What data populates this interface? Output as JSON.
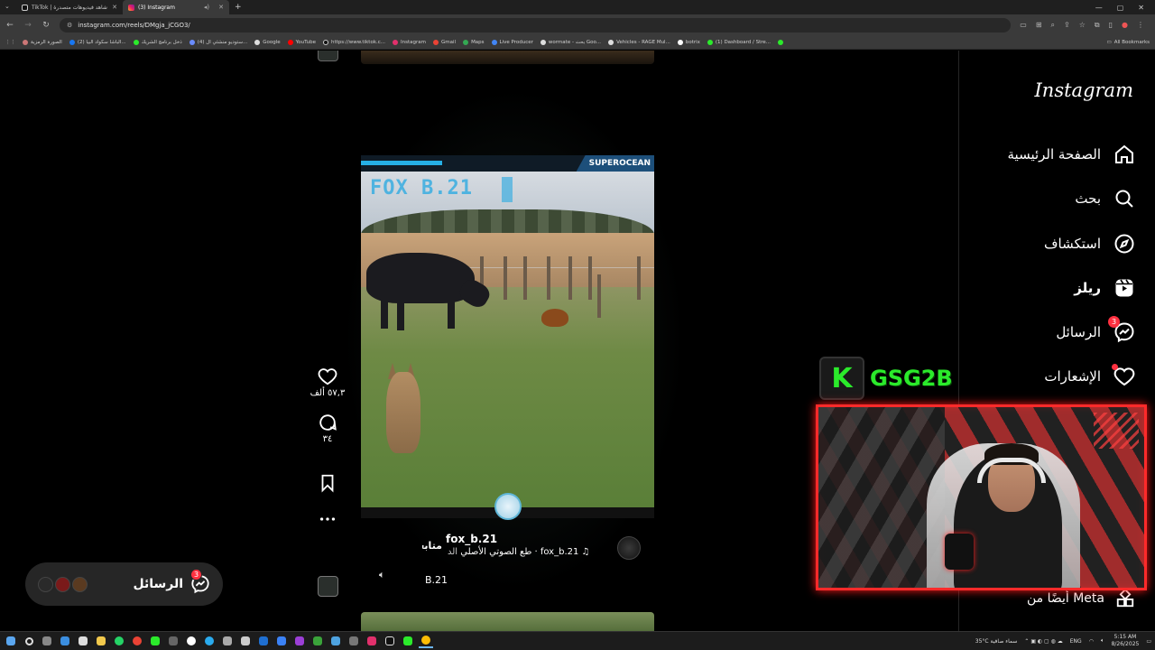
{
  "browser": {
    "tabs": [
      {
        "label": "TikTok | شاهد فيديوهات متصدرة",
        "active": false
      },
      {
        "label": "(3) Instagram",
        "active": true
      }
    ],
    "url": "instagram.com/reels/DMgja_jCGO3/",
    "bookmarks": [
      "الصورة الرمزية",
      "(2) الباشا سكواد البيا...",
      "ذخل برنامج الشريك",
      "(4) ستوديو منشئي ال...",
      "Google",
      "YouTube",
      "https://www.tiktok.c...",
      "Instagram",
      "Gmail",
      "Maps",
      "Live Producer",
      "wormate - بحث Goo...",
      "Vehicles - RAGE Mul...",
      "botrix",
      "(1) Dashboard / Stre..."
    ],
    "all_bookmarks": "All Bookmarks"
  },
  "sidebar": {
    "logo": "Instagram",
    "items": [
      {
        "label": "الصفحة الرئيسية",
        "icon": "home-icon"
      },
      {
        "label": "بحث",
        "icon": "search-icon"
      },
      {
        "label": "استكشاف",
        "icon": "compass-icon"
      },
      {
        "label": "ريلز",
        "icon": "reels-icon"
      },
      {
        "label": "الرسائل",
        "icon": "messenger-icon",
        "badge": "3"
      },
      {
        "label": "الإشعارات",
        "icon": "heart-icon"
      }
    ],
    "meta_label": "أيضًا من Meta"
  },
  "reel": {
    "overlay_brand": "SUPEROCEAN",
    "overlay_title": "FOX B.21",
    "username": "fox_b.21",
    "follow": "متابعة",
    "audio_prefix": "الد",
    "audio": "fox_b.21 · طع الصوتي الأصلي",
    "description": "B.21",
    "likes": "٥٧,٣ ألف",
    "comments": "٣٤"
  },
  "messages_pill": {
    "label": "الرسائل",
    "badge": "3"
  },
  "stream": {
    "logo_letter": "K",
    "logo_text": "GSG2B"
  },
  "taskbar": {
    "weather": "35°C  سماء صافية",
    "lang": "ENG",
    "time": "5:15 AM",
    "date": "8/26/2025"
  },
  "colors": {
    "badge": "#ff3040",
    "stream_green": "#2bea2b",
    "cam_border": "#ff2a2a",
    "overlay_blue": "#4fb3e0"
  }
}
